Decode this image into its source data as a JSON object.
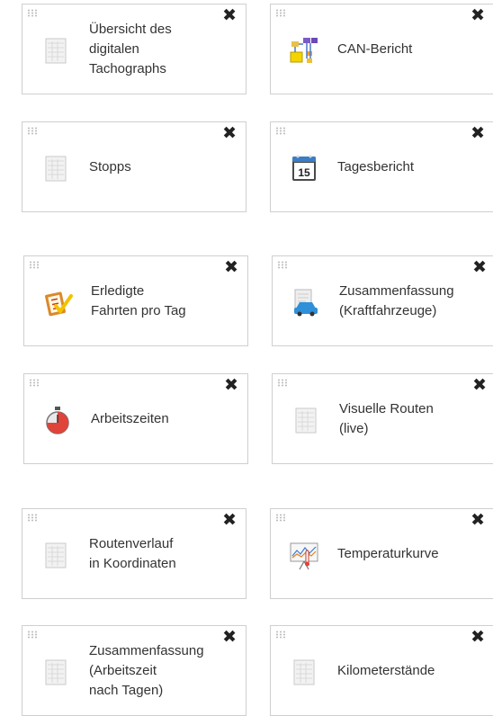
{
  "close_symbol": "✖",
  "tiles": [
    {
      "label": "Übersicht des\ndigitalen\nTachographs",
      "icon": "report-sheet-icon"
    },
    {
      "label": "CAN-Bericht",
      "icon": "can-network-icon"
    },
    {
      "label": "Stopps",
      "icon": "report-sheet-icon"
    },
    {
      "label": "Tagesbericht",
      "icon": "calendar-icon",
      "calendar_day": "15"
    },
    {
      "label": "Erledigte\nFahrten pro Tag",
      "icon": "checklist-icon"
    },
    {
      "label": "Zusammenfassung\n(Kraftfahrzeuge)",
      "icon": "car-document-icon"
    },
    {
      "label": "Arbeitszeiten",
      "icon": "stopwatch-icon"
    },
    {
      "label": "Visuelle Routen\n(live)",
      "icon": "report-sheet-icon"
    },
    {
      "label": "Routenverlauf\nin Koordinaten",
      "icon": "report-sheet-icon"
    },
    {
      "label": "Temperaturkurve",
      "icon": "temperature-chart-icon"
    },
    {
      "label": "Zusammenfassung\n(Arbeitszeit\nnach Tagen)",
      "icon": "report-sheet-icon"
    },
    {
      "label": "Kilometerstände",
      "icon": "report-sheet-icon"
    }
  ]
}
